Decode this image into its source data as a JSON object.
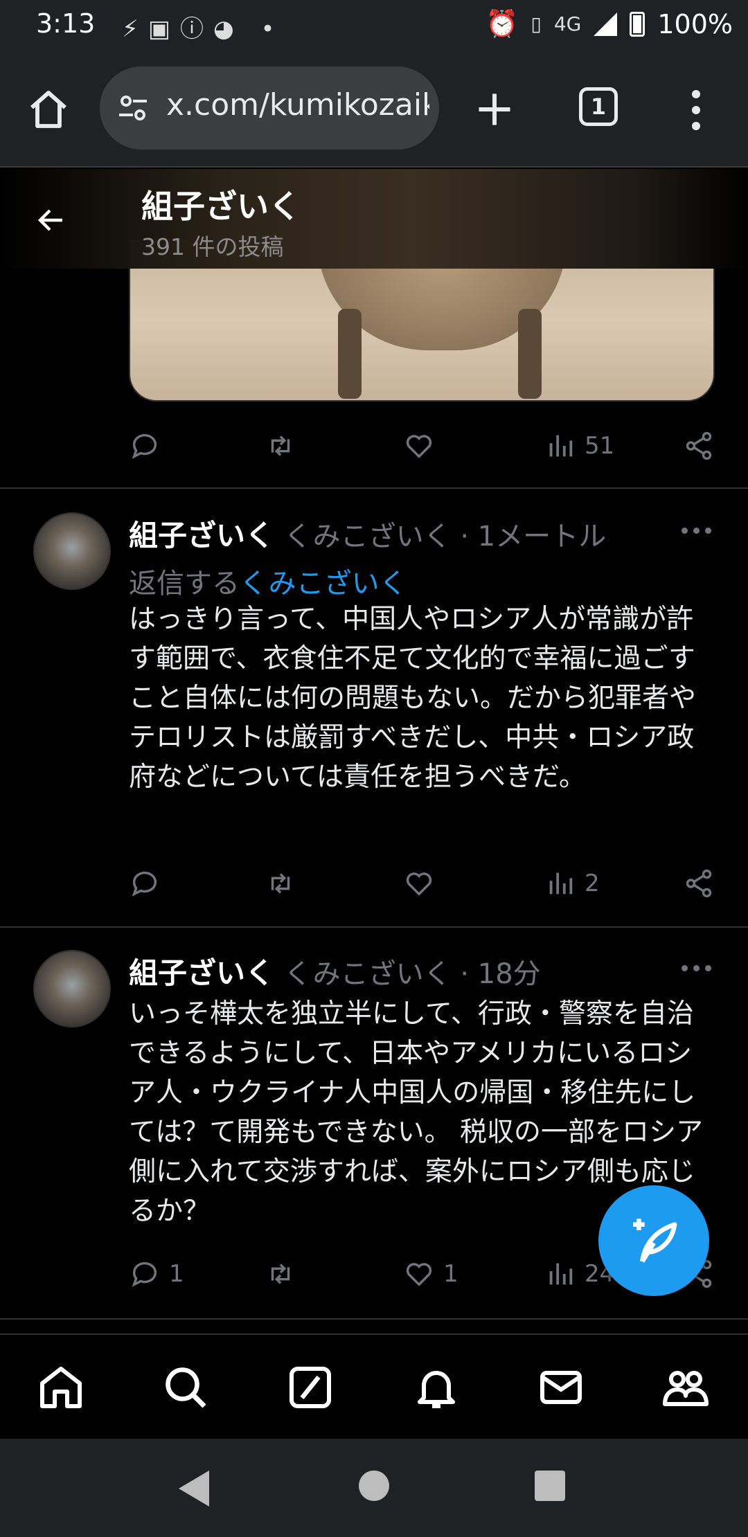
{
  "status_bar": {
    "time": "3:13",
    "network": "4G",
    "battery": "100%"
  },
  "browser": {
    "url": "x.com/kumikozaiku",
    "tab_count": "1"
  },
  "profile": {
    "name": "組子ざいく",
    "post_count": "391 件の投稿"
  },
  "first_post": {
    "views": "51"
  },
  "tweets": [
    {
      "name": "組子ざいく",
      "handle": "くみこざいく · 1メートル",
      "reply_prefix": "返信する",
      "reply_to": "くみこざいく",
      "text": "はっきり言って、中国人やロシア人が常識が許す範囲で、衣食住不足て文化的で幸福に過ごすこと自体には何の問題もない。だから犯罪者やテロリストは厳罰すべきだし、中共・ロシア政府などについては責任を担うべきだ。",
      "replies": "",
      "likes": "",
      "views": "2"
    },
    {
      "name": "組子ざいく",
      "handle": "くみこざいく · 18分",
      "text": "いっそ樺太を独立半にして、行政・警察を自治できるようにして、日本やアメリカにいるロシア人・ウクライナ人中国人の帰国・移住先にしては？て開発もできない。 税収の一部をロシア側に入れて交渉すれば、案外にロシア側も応じるか？",
      "replies": "1",
      "likes": "1",
      "views": "24"
    }
  ],
  "colors": {
    "accent": "#1d9bf0",
    "muted": "#71767b",
    "divider": "#2f3336",
    "background": "#000000",
    "chrome": "#202124"
  }
}
